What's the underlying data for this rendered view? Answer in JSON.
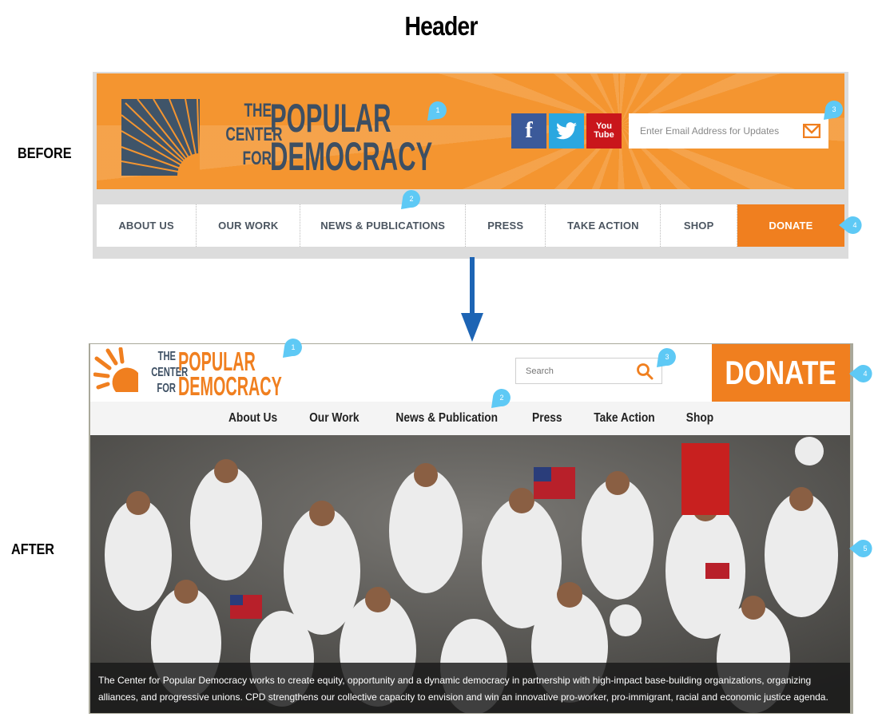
{
  "heading": "Header",
  "labels": {
    "before": "BEFORE",
    "after": "AFTER"
  },
  "badges": [
    "1",
    "2",
    "3",
    "4",
    "5"
  ],
  "colors": {
    "orange": "#f49530",
    "donate_orange": "#f07f1f",
    "slate": "#3d4f63",
    "badge_blue": "#5ec9f5",
    "arrow_blue": "#1d64b4"
  },
  "before": {
    "logo": {
      "small_lines": [
        "THE",
        "CENTER",
        "FOR"
      ],
      "big_lines": [
        "POPULAR",
        "DEMOCRACY"
      ]
    },
    "social": [
      {
        "name": "facebook-icon",
        "glyph": "f",
        "color": "#3b5a9a"
      },
      {
        "name": "twitter-icon",
        "glyph": "t",
        "color": "#2aa7e0"
      },
      {
        "name": "youtube-icon",
        "glyph": "You Tube",
        "color": "#c9161b"
      }
    ],
    "email_placeholder": "Enter Email Address for Updates",
    "nav": [
      "ABOUT US",
      "OUR WORK",
      "NEWS & PUBLICATIONS",
      "PRESS",
      "TAKE ACTION",
      "SHOP"
    ],
    "donate": "DONATE"
  },
  "after": {
    "logo": {
      "small_lines": [
        "THE",
        "CENTER",
        "FOR"
      ],
      "big_lines": [
        "POPULAR",
        "DEMOCRACY"
      ]
    },
    "search_placeholder": "Search",
    "donate": "DONATE",
    "nav": [
      "About Us",
      "Our Work",
      "News & Publication",
      "Press",
      "Take Action",
      "Shop"
    ],
    "caption_lines": [
      "The Center for Popular Democracy works to create equity, opportunity and a dynamic democracy in partnership with high-impact base-building organizations, organizing",
      "alliances, and progressive unions. CPD strengthens our collective capacity to envision and win an innovative pro-worker, pro-immigrant, racial and economic justice agenda."
    ]
  }
}
